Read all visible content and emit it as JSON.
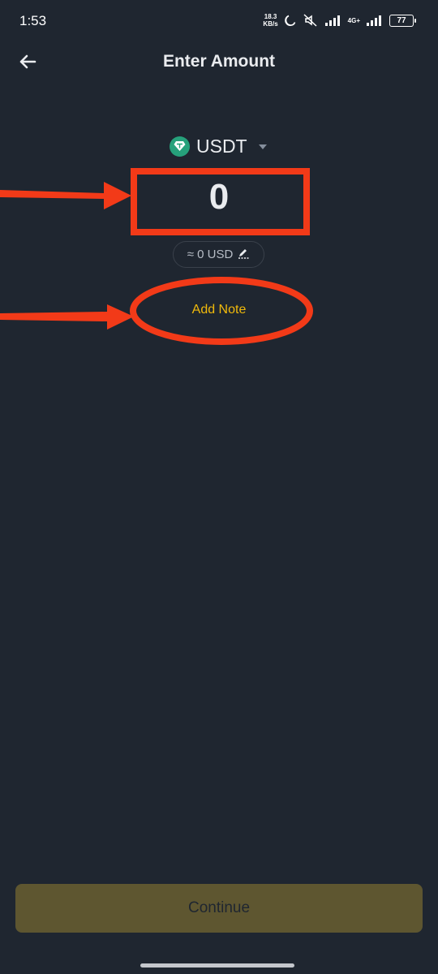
{
  "status_bar": {
    "time": "1:53",
    "net_speed_value": "18.3",
    "net_speed_unit": "KB/s",
    "signal_label": "4G+",
    "battery_level": "77"
  },
  "header": {
    "title": "Enter Amount",
    "back_icon": "arrow-left-icon"
  },
  "coin": {
    "name": "USDT",
    "icon": "tether-icon",
    "icon_color": "#26a17b"
  },
  "amount": {
    "value": "0",
    "usd_equivalent": "≈ 0 USD",
    "edit_icon": "edit-icon"
  },
  "note": {
    "label": "Add Note"
  },
  "footer": {
    "continue_label": "Continue"
  },
  "colors": {
    "background": "#1f2630",
    "accent": "#f0b90b",
    "continue_disabled": "#5e5630",
    "annotation": "#f23a18"
  }
}
